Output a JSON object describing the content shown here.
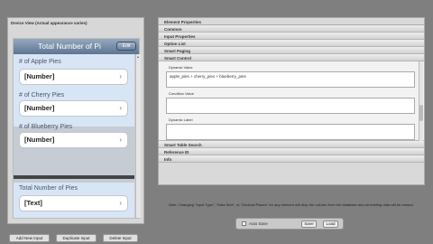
{
  "left": {
    "header": "Device View (Actual appearance varies)",
    "device_title": "Total Number of Pi",
    "edit_label": "Edit",
    "fields": [
      {
        "label": "# of Apple Pies",
        "value": "[Number]"
      },
      {
        "label": "# of Cherry Pies",
        "value": "[Number]"
      },
      {
        "label": "# of Blueberry Pies",
        "value": "[Number]"
      }
    ],
    "total": {
      "label": "Total Number of Pies",
      "value": "[Text]"
    },
    "buttons": {
      "add": "Add New Input",
      "duplicate": "Duplicate Input",
      "delete": "Delete Input"
    }
  },
  "right": {
    "header": "Element Properties",
    "sections_top": [
      "Common",
      "Input Properties",
      "Option List",
      "Smart Paging",
      "Smart Control"
    ],
    "smart_control": {
      "dynamic_value_label": "Dynamic Value",
      "dynamic_value": "apple_pies + cherry_pies + blueberry_pies",
      "condition_label": "Condition Value",
      "dynamic_label_label": "Dynamic Label"
    },
    "sections_bottom": [
      "Smart Table Search",
      "Reference ID",
      "Info"
    ]
  },
  "note": "Note: Changing \"Input Type\", \"Data Size\", or \"Decimal Places\" for any element will drop the column from the database and all existing data will be erased.",
  "bottom": {
    "auto_save": "Auto Save",
    "save": "Save",
    "load": "Load"
  }
}
